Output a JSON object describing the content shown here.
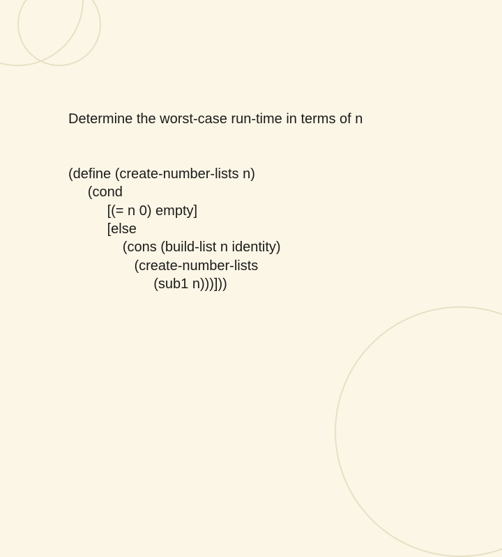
{
  "prompt": "Determine the worst-case run-time in terms of n",
  "code": {
    "l1": "(define (create-number-lists n)",
    "l2": "     (cond",
    "l3": "          [(= n 0) empty]",
    "l4": "          [else",
    "l5": "              (cons (build-list n identity)",
    "l6": "                 (create-number-lists",
    "l7": "                      (sub1 n)))]))"
  }
}
